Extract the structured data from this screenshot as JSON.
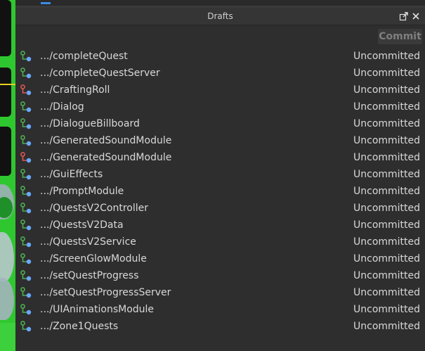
{
  "panel": {
    "title": "Drafts",
    "commit_label": "Commit"
  },
  "colors": {
    "panel_bg": "#2e2e2e",
    "text": "#d8d8d8",
    "icon_green": "#4caf50",
    "icon_red": "#e05555",
    "icon_blue": "#6aa8ff"
  },
  "drafts": [
    {
      "name": ".../completeQuest",
      "status": "Uncommitted",
      "icon": "script-green-icon"
    },
    {
      "name": ".../completeQuestServer",
      "status": "Uncommitted",
      "icon": "script-green-icon"
    },
    {
      "name": ".../CraftingRoll",
      "status": "Uncommitted",
      "icon": "script-red-icon"
    },
    {
      "name": ".../Dialog",
      "status": "Uncommitted",
      "icon": "script-green-icon"
    },
    {
      "name": ".../DialogueBillboard",
      "status": "Uncommitted",
      "icon": "script-green-icon"
    },
    {
      "name": ".../GeneratedSoundModule",
      "status": "Uncommitted",
      "icon": "script-green-icon"
    },
    {
      "name": ".../GeneratedSoundModule",
      "status": "Uncommitted",
      "icon": "script-red-icon"
    },
    {
      "name": ".../GuiEffects",
      "status": "Uncommitted",
      "icon": "script-green-icon"
    },
    {
      "name": ".../PromptModule",
      "status": "Uncommitted",
      "icon": "script-green-icon"
    },
    {
      "name": ".../QuestsV2Controller",
      "status": "Uncommitted",
      "icon": "script-green-icon"
    },
    {
      "name": ".../QuestsV2Data",
      "status": "Uncommitted",
      "icon": "script-green-icon"
    },
    {
      "name": ".../QuestsV2Service",
      "status": "Uncommitted",
      "icon": "script-green-icon"
    },
    {
      "name": ".../ScreenGlowModule",
      "status": "Uncommitted",
      "icon": "script-green-icon"
    },
    {
      "name": ".../setQuestProgress",
      "status": "Uncommitted",
      "icon": "script-green-icon"
    },
    {
      "name": ".../setQuestProgressServer",
      "status": "Uncommitted",
      "icon": "script-green-icon"
    },
    {
      "name": ".../UIAnimationsModule",
      "status": "Uncommitted",
      "icon": "script-green-icon"
    },
    {
      "name": ".../Zone1Quests",
      "status": "Uncommitted",
      "icon": "script-green-icon"
    }
  ]
}
